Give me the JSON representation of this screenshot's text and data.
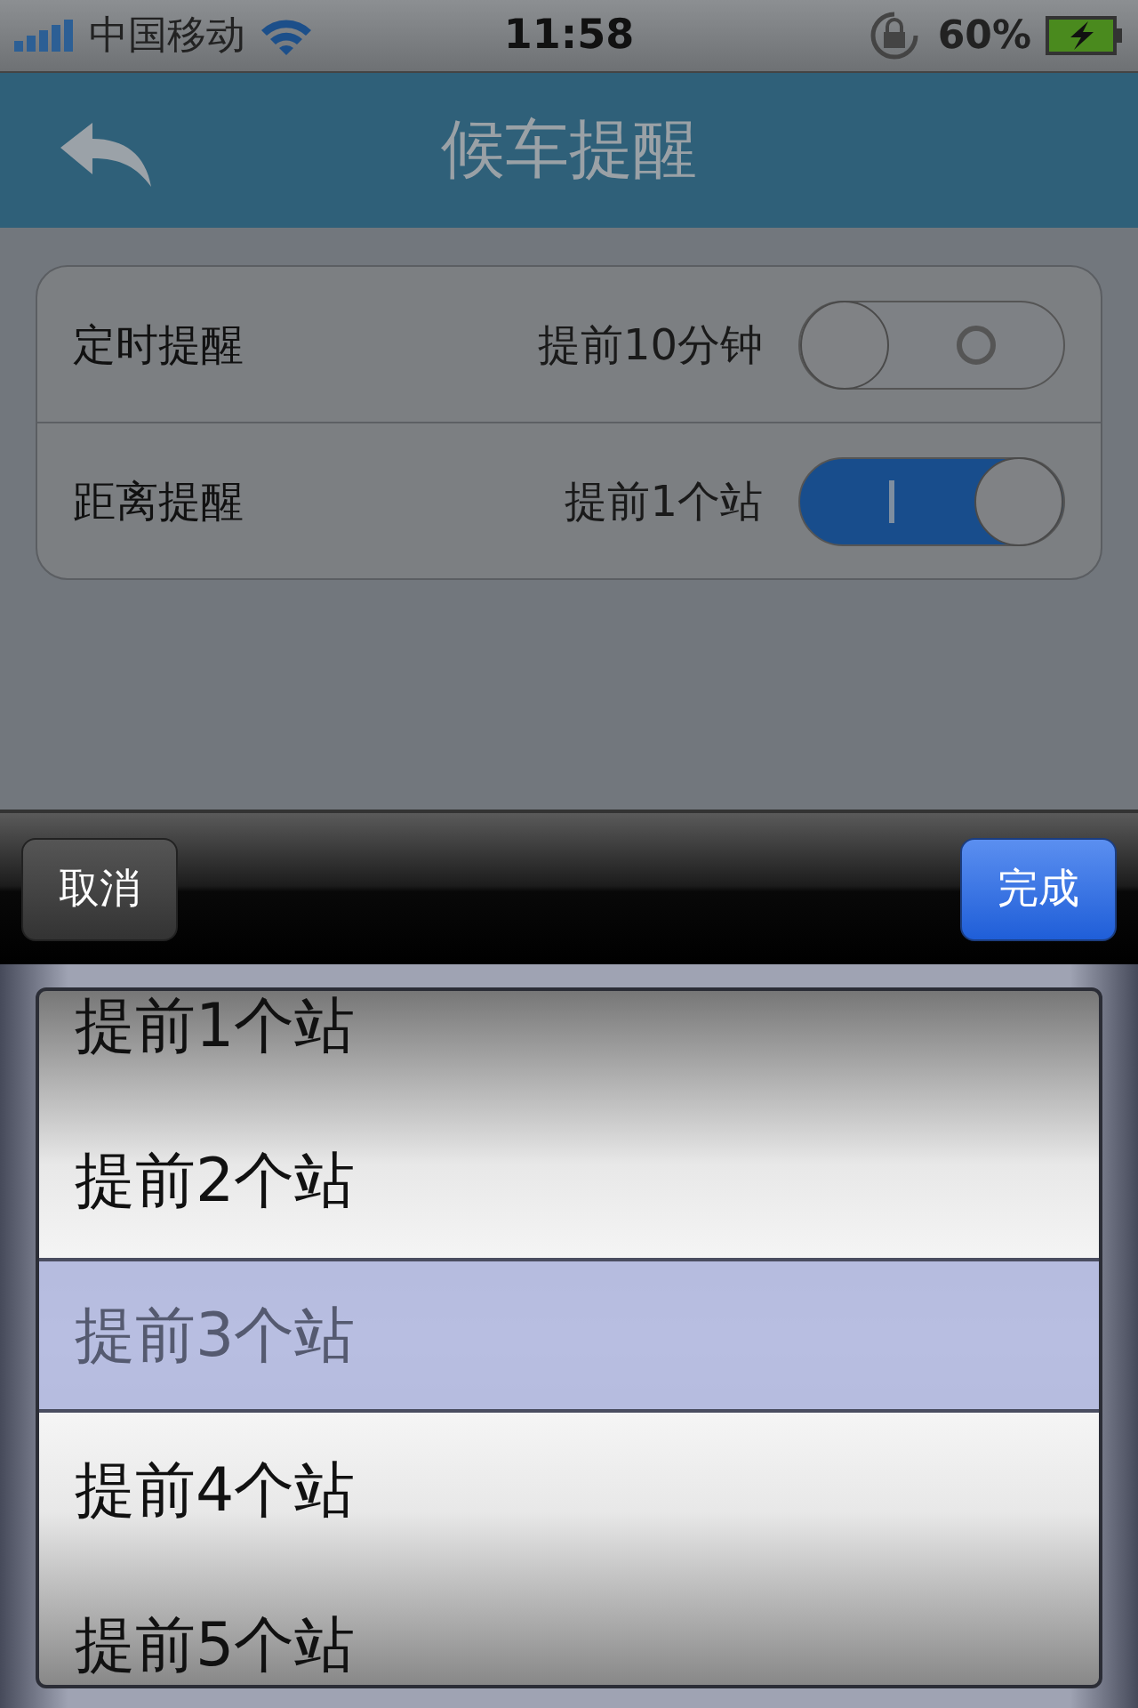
{
  "status_bar": {
    "carrier": "中国移动",
    "time": "11:58",
    "battery": "60%"
  },
  "nav": {
    "title": "候车提醒"
  },
  "settings": [
    {
      "label": "定时提醒",
      "value": "提前10分钟",
      "on": false
    },
    {
      "label": "距离提醒",
      "value": "提前1个站",
      "on": true
    }
  ],
  "toolbar": {
    "cancel": "取消",
    "done": "完成"
  },
  "picker": [
    {
      "label": "提前1个站",
      "selected": false
    },
    {
      "label": "提前2个站",
      "selected": false
    },
    {
      "label": "提前3个站",
      "selected": true
    },
    {
      "label": "提前4个站",
      "selected": false
    },
    {
      "label": "提前5个站",
      "selected": false
    }
  ]
}
